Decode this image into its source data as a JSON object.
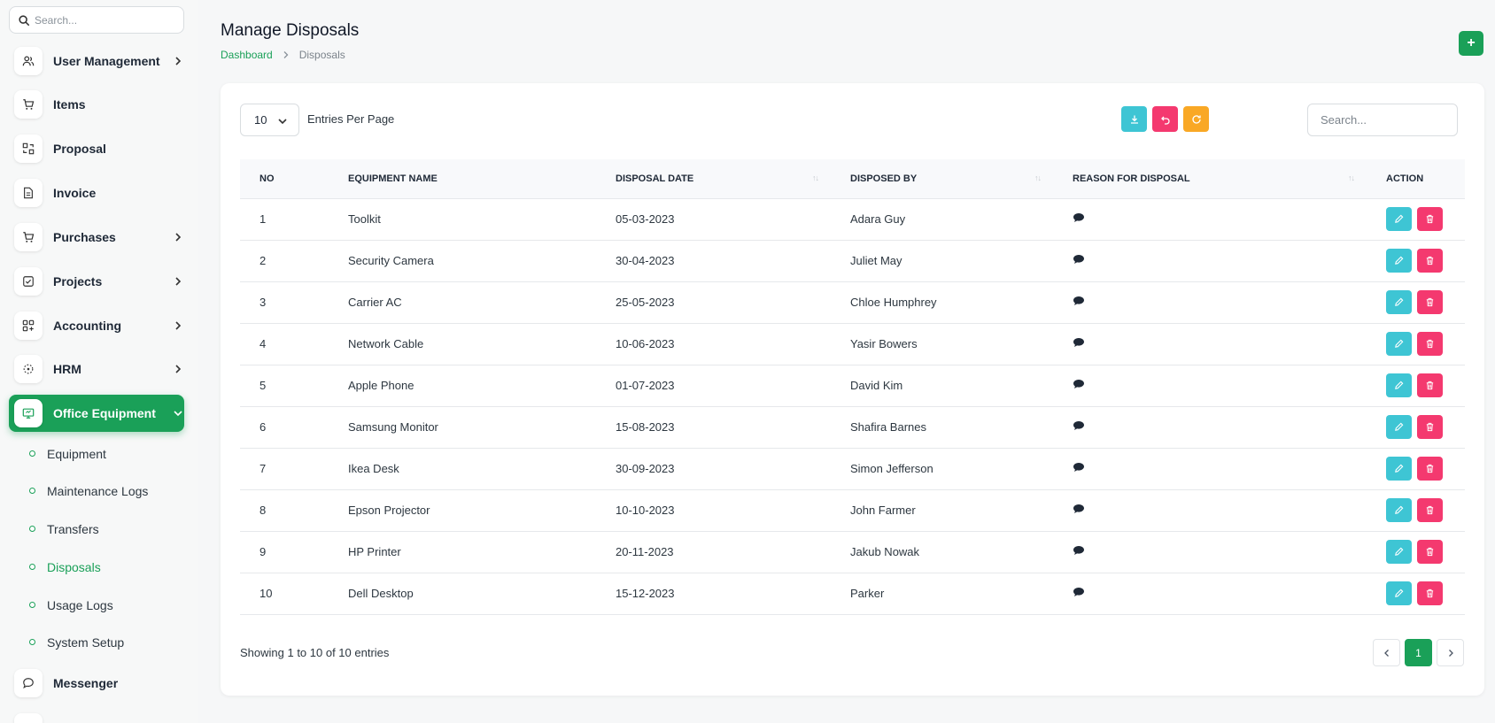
{
  "sidebar": {
    "search_placeholder": "Search...",
    "items": [
      {
        "label": "User Management",
        "icon": "users-icon",
        "has_children": true
      },
      {
        "label": "Items",
        "icon": "cart-icon",
        "has_children": false
      },
      {
        "label": "Proposal",
        "icon": "exchange-icon",
        "has_children": false
      },
      {
        "label": "Invoice",
        "icon": "file-icon",
        "has_children": false
      },
      {
        "label": "Purchases",
        "icon": "cart-icon",
        "has_children": true
      },
      {
        "label": "Projects",
        "icon": "checkbox-icon",
        "has_children": true
      },
      {
        "label": "Accounting",
        "icon": "grid-plus-icon",
        "has_children": true
      },
      {
        "label": "HRM",
        "icon": "hrm-icon",
        "has_children": true
      },
      {
        "label": "Office Equipment",
        "icon": "monitor-icon",
        "has_children": true,
        "active": true
      }
    ],
    "sub_items": [
      {
        "label": "Equipment"
      },
      {
        "label": "Maintenance Logs"
      },
      {
        "label": "Transfers"
      },
      {
        "label": "Disposals",
        "current": true
      },
      {
        "label": "Usage Logs"
      },
      {
        "label": "System Setup"
      }
    ],
    "after_items": [
      {
        "label": "Messenger",
        "icon": "chat-icon"
      }
    ]
  },
  "header": {
    "title": "Manage Disposals",
    "breadcrumb": {
      "link": "Dashboard",
      "current": "Disposals"
    },
    "add_label": "+"
  },
  "controls": {
    "per_page_value": "10",
    "per_page_label": "Entries Per Page",
    "search_placeholder": "Search..."
  },
  "table": {
    "columns": [
      "NO",
      "EQUIPMENT NAME",
      "DISPOSAL DATE",
      "DISPOSED BY",
      "REASON FOR DISPOSAL",
      "ACTION"
    ],
    "rows": [
      {
        "no": "1",
        "name": "Toolkit",
        "date": "05-03-2023",
        "by": "Adara Guy"
      },
      {
        "no": "2",
        "name": "Security Camera",
        "date": "30-04-2023",
        "by": "Juliet May"
      },
      {
        "no": "3",
        "name": "Carrier AC",
        "date": "25-05-2023",
        "by": "Chloe Humphrey"
      },
      {
        "no": "4",
        "name": "Network Cable",
        "date": "10-06-2023",
        "by": "Yasir Bowers"
      },
      {
        "no": "5",
        "name": "Apple Phone",
        "date": "01-07-2023",
        "by": "David Kim"
      },
      {
        "no": "6",
        "name": "Samsung Monitor",
        "date": "15-08-2023",
        "by": "Shafira Barnes"
      },
      {
        "no": "7",
        "name": "Ikea Desk",
        "date": "30-09-2023",
        "by": "Simon Jefferson"
      },
      {
        "no": "8",
        "name": "Epson Projector",
        "date": "10-10-2023",
        "by": "John Farmer"
      },
      {
        "no": "9",
        "name": "HP Printer",
        "date": "20-11-2023",
        "by": "Jakub Nowak"
      },
      {
        "no": "10",
        "name": "Dell Desktop",
        "date": "15-12-2023",
        "by": "Parker"
      }
    ]
  },
  "footer": {
    "showing": "Showing 1 to 10 of 10 entries",
    "current_page": "1"
  },
  "colors": {
    "brand": "#1aa058",
    "export": "#3ec5d4",
    "undo": "#f4396f",
    "refresh": "#f9a825"
  }
}
